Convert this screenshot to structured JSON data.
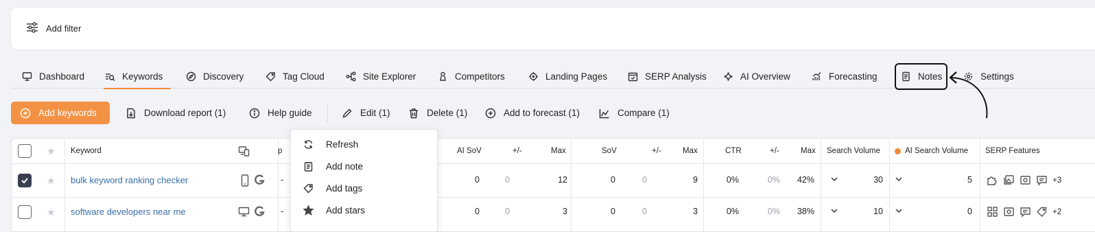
{
  "filter": {
    "label": "Add filter"
  },
  "tabs": [
    {
      "label": "Dashboard"
    },
    {
      "label": "Keywords"
    },
    {
      "label": "Discovery"
    },
    {
      "label": "Tag Cloud"
    },
    {
      "label": "Site Explorer"
    },
    {
      "label": "Competitors"
    },
    {
      "label": "Landing Pages"
    },
    {
      "label": "SERP Analysis"
    },
    {
      "label": "AI Overview"
    },
    {
      "label": "Forecasting"
    },
    {
      "label": "Notes"
    },
    {
      "label": "Settings"
    }
  ],
  "active_tab": "Keywords",
  "toolbar": {
    "add_keywords": "Add keywords",
    "download": "Download report (1)",
    "help": "Help guide",
    "edit": "Edit (1)",
    "delete": "Delete (1)",
    "forecast": "Add to forecast (1)",
    "compare": "Compare (1)"
  },
  "menu": {
    "items": [
      {
        "label": "Refresh",
        "icon": "refresh-icon"
      },
      {
        "label": "Add note",
        "icon": "note-icon"
      },
      {
        "label": "Add tags",
        "icon": "tag-icon"
      },
      {
        "label": "Add stars",
        "icon": "star-icon"
      }
    ]
  },
  "table": {
    "headers": {
      "keyword": "Keyword",
      "p": "p",
      "ai_sov": "AI SoV",
      "pm1": "+/-",
      "max1": "Max",
      "sov": "SoV",
      "pm2": "+/-",
      "max2": "Max",
      "ctr": "CTR",
      "pm3": "+/-",
      "max3": "Max",
      "search_volume": "Search Volume",
      "ai_search_volume": "AI Search Volume",
      "serp": "SERP Features"
    },
    "rows": [
      {
        "checked": true,
        "keyword": "bulk keyword ranking checker",
        "p": "-",
        "ai_sov": "0",
        "pm1": "0",
        "max1": "12",
        "sov": "0",
        "pm2": "0",
        "max2": "9",
        "ctr": "0%",
        "pm3": "0%",
        "max3": "42%",
        "search_volume": "30",
        "ai_search_volume": "5",
        "serp_more": "+3"
      },
      {
        "checked": false,
        "keyword": "software developers near me",
        "p": "-",
        "ai_sov": "0",
        "pm1": "0",
        "max1": "3",
        "sov": "0",
        "pm2": "0",
        "max2": "3",
        "ctr": "0%",
        "pm3": "0%",
        "max3": "38%",
        "search_volume": "10",
        "ai_search_volume": "0",
        "serp_more": "+2"
      }
    ]
  },
  "colors": {
    "accent": "#f39244",
    "link": "#3b6ea8",
    "dim": "#9aa0a8"
  }
}
